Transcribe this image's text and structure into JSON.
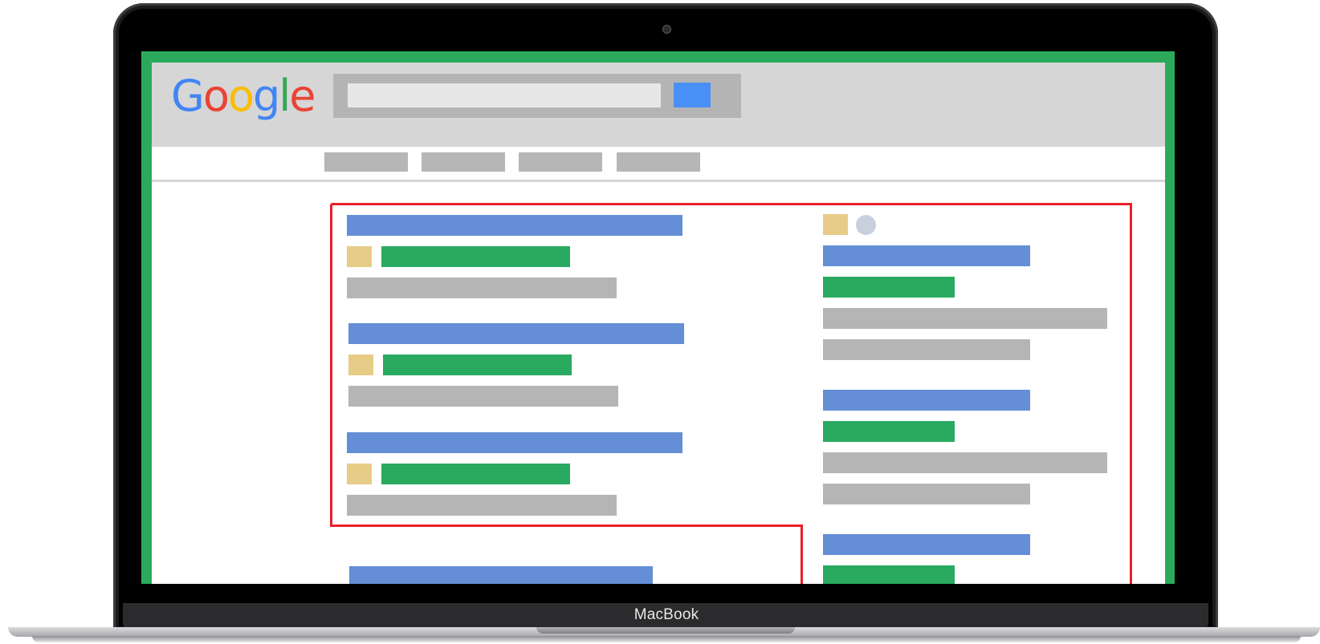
{
  "device": {
    "brand_label": "MacBook"
  },
  "page": {
    "logo": {
      "text": "Google",
      "letters": [
        {
          "char": "G",
          "color": "#4285f4"
        },
        {
          "char": "o",
          "color": "#ea4335"
        },
        {
          "char": "o",
          "color": "#fbbc05"
        },
        {
          "char": "g",
          "color": "#4285f4"
        },
        {
          "char": "l",
          "color": "#34a853"
        },
        {
          "char": "e",
          "color": "#ea4335"
        }
      ]
    },
    "search": {
      "value": "",
      "placeholder": ""
    },
    "nav_tab_count": 4
  },
  "colors": {
    "screen_border": "#2baa5b",
    "header_bg": "#d6d6d6",
    "search_button": "#4a8ff5",
    "result_title_bar": "#648fd6",
    "result_url_bar": "#2aaa60",
    "result_snippet_bar": "#b5b5b5",
    "favicon": "#e6cc86",
    "highlight_outline": "#e8202a"
  },
  "icons": {
    "search_button_icon": "solid-blue-square",
    "favicon_icon": "square-favicon",
    "avatar_icon": "circle-avatar"
  }
}
